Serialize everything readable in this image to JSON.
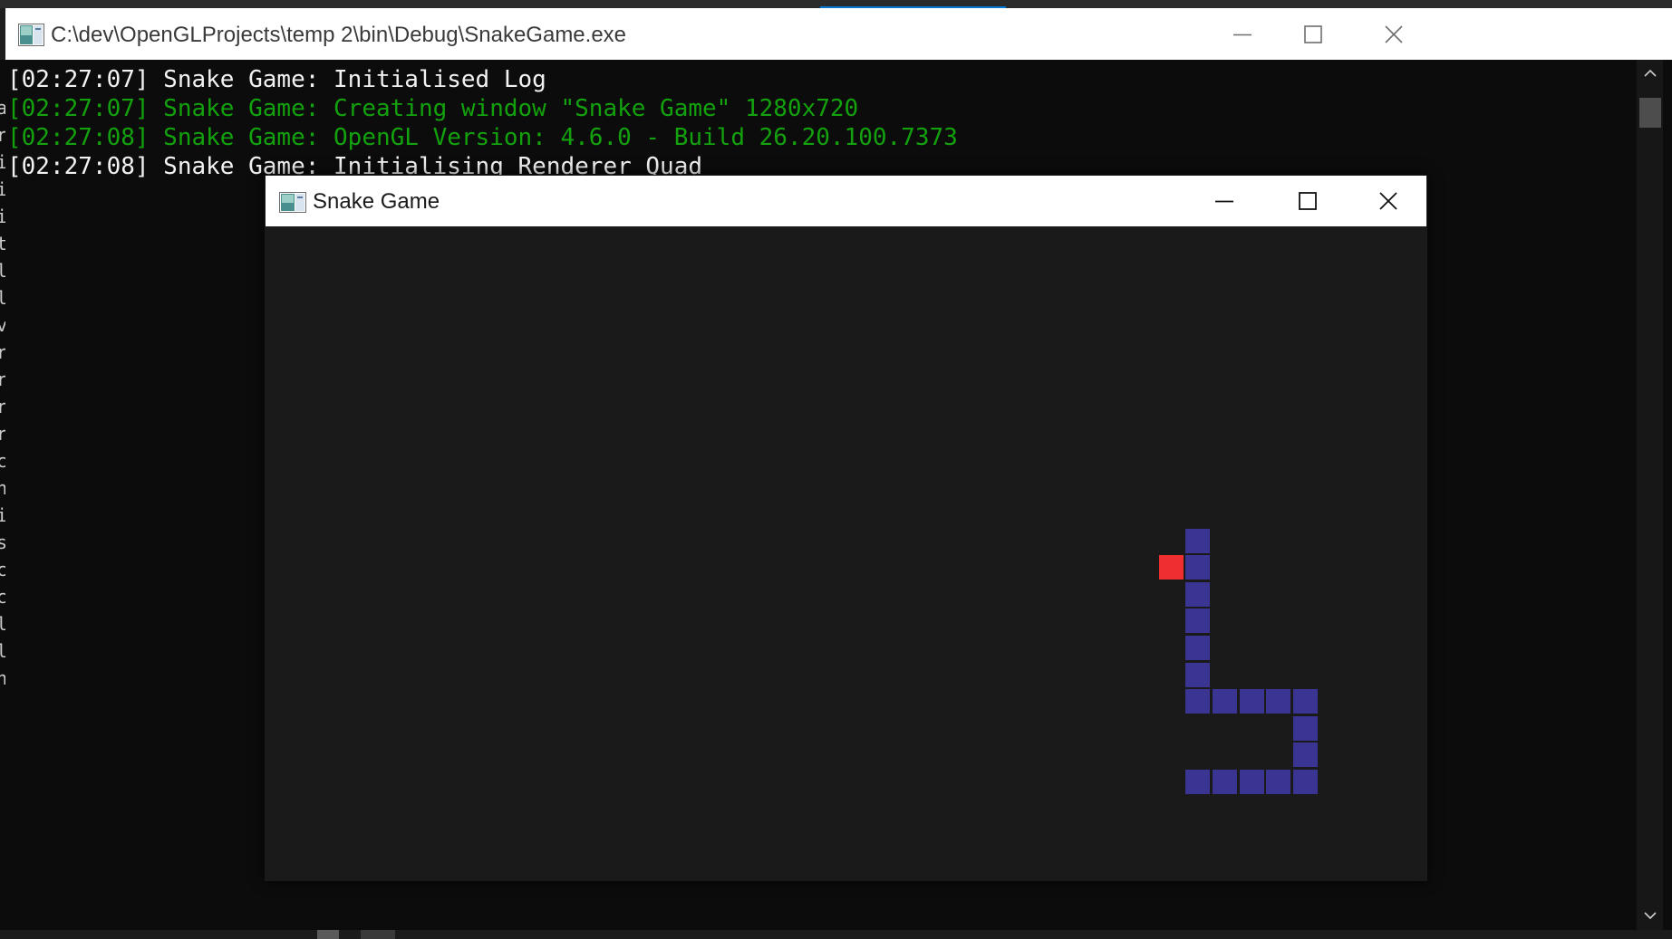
{
  "console_window": {
    "title": "C:\\dev\\OpenGLProjects\\temp 2\\bin\\Debug\\SnakeGame.exe",
    "icon": "console-app-icon",
    "log_lines": [
      {
        "text": "[02:27:07] Snake Game: Initialised Log",
        "color": "#f2f2f2"
      },
      {
        "text": "[02:27:07] Snake Game: Creating window \"Snake Game\" 1280x720",
        "color": "#13a10e"
      },
      {
        "text": "[02:27:08] Snake Game: OpenGL Version: 4.6.0 - Build 26.20.100.7373",
        "color": "#13a10e"
      },
      {
        "text": "[02:27:08] Snake Game: Initialising Renderer Quad",
        "color": "#f2f2f2"
      }
    ],
    "background_color": "#0c0c0c"
  },
  "left_edge_glyphs": [
    "a",
    "r",
    "i",
    "i",
    "i",
    "t",
    "l",
    "l",
    "v",
    "r",
    "r",
    "r",
    "r",
    "c",
    "n",
    "i",
    "s",
    "c",
    "c",
    "l",
    "l",
    "n"
  ],
  "game_window": {
    "title": "Snake Game",
    "icon": "game-app-icon",
    "background_color": "#1a1a1a",
    "food": {
      "col": 33,
      "row": 12,
      "color": "#ef2f2f"
    },
    "snake": {
      "color": "#3a3592",
      "segments": [
        {
          "col": 34,
          "row": 11
        },
        {
          "col": 34,
          "row": 12
        },
        {
          "col": 34,
          "row": 13
        },
        {
          "col": 34,
          "row": 14
        },
        {
          "col": 34,
          "row": 15
        },
        {
          "col": 34,
          "row": 16
        },
        {
          "col": 34,
          "row": 17
        },
        {
          "col": 35,
          "row": 17
        },
        {
          "col": 36,
          "row": 17
        },
        {
          "col": 37,
          "row": 17
        },
        {
          "col": 38,
          "row": 17
        },
        {
          "col": 38,
          "row": 18
        },
        {
          "col": 38,
          "row": 19
        },
        {
          "col": 38,
          "row": 20
        },
        {
          "col": 37,
          "row": 20
        },
        {
          "col": 36,
          "row": 20
        },
        {
          "col": 35,
          "row": 20
        },
        {
          "col": 34,
          "row": 20
        }
      ]
    }
  }
}
